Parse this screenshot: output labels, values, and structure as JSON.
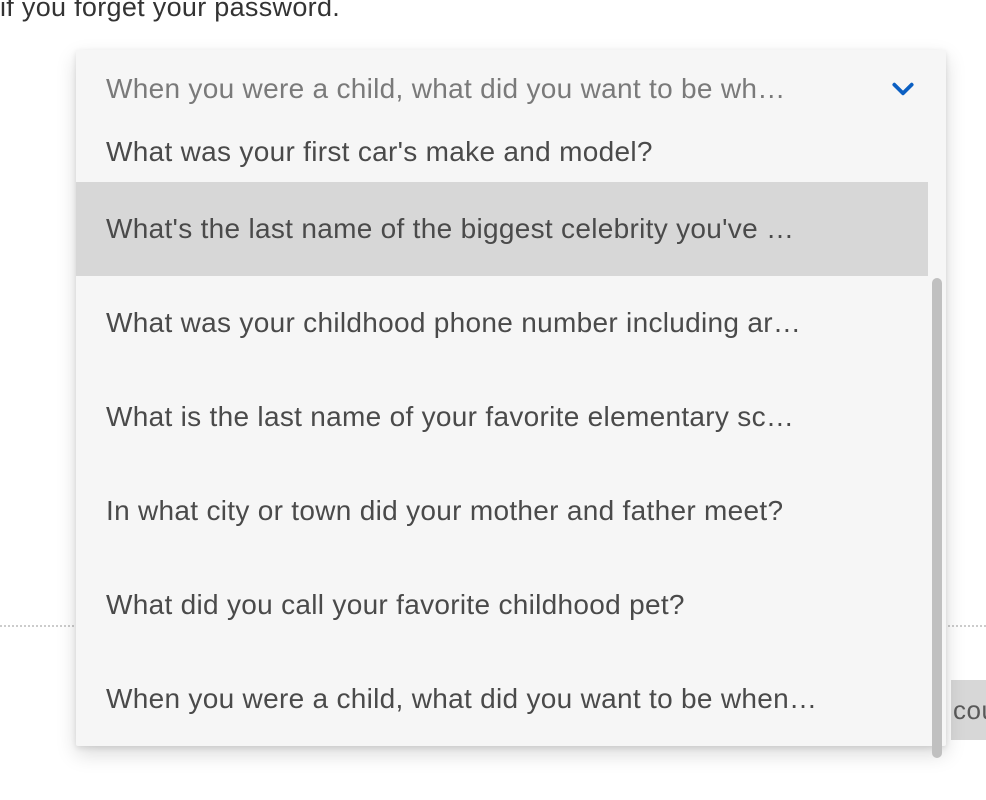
{
  "header": {
    "partial_text": "if you forget your password."
  },
  "button": {
    "partial_label": "cou"
  },
  "dropdown": {
    "selected_text": "When you were a child, what did you want to be wh…",
    "options": [
      {
        "text": "What was your first car's make and model?",
        "partial": true,
        "highlighted": false
      },
      {
        "text": "What's the last name of the biggest celebrity you've …",
        "partial": false,
        "highlighted": true
      },
      {
        "text": "What was your childhood phone number including ar…",
        "partial": false,
        "highlighted": false
      },
      {
        "text": "What is the last name of your favorite elementary sc…",
        "partial": false,
        "highlighted": false
      },
      {
        "text": "In what city or town did your mother and father meet?",
        "partial": false,
        "highlighted": false
      },
      {
        "text": "What did you call your favorite childhood pet?",
        "partial": false,
        "highlighted": false
      },
      {
        "text": "When you were a child, what did you want to be when…",
        "partial": false,
        "highlighted": false
      }
    ]
  }
}
